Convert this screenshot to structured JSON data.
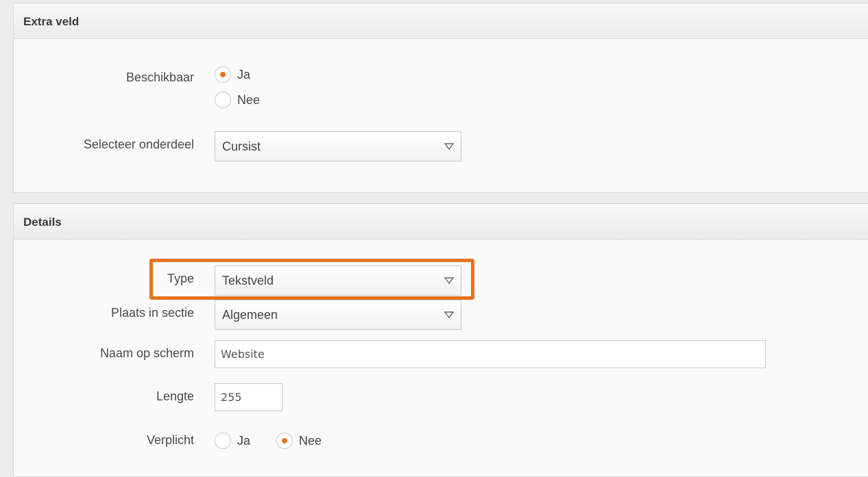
{
  "extra_veld": {
    "title": "Extra veld",
    "beschikbaar": {
      "label": "Beschikbaar",
      "options": [
        {
          "label": "Ja",
          "selected": true
        },
        {
          "label": "Nee",
          "selected": false
        }
      ]
    },
    "onderdeel": {
      "label": "Selecteer onderdeel",
      "value": "Cursist"
    }
  },
  "details": {
    "title": "Details",
    "type": {
      "label": "Type",
      "value": "Tekstveld"
    },
    "plaats": {
      "label": "Plaats in sectie",
      "value": "Algemeen"
    },
    "naam": {
      "label": "Naam op scherm",
      "value": "Website"
    },
    "lengte": {
      "label": "Lengte",
      "value": "255"
    },
    "verplicht": {
      "label": "Verplicht",
      "options": [
        {
          "label": "Ja",
          "selected": false
        },
        {
          "label": "Nee",
          "selected": true
        }
      ]
    }
  },
  "colors": {
    "accent": "#e8731e",
    "border": "#c9c9c9",
    "panel_background": "#fafafa"
  },
  "icons": {
    "select_caret": "caret-down-icon"
  }
}
